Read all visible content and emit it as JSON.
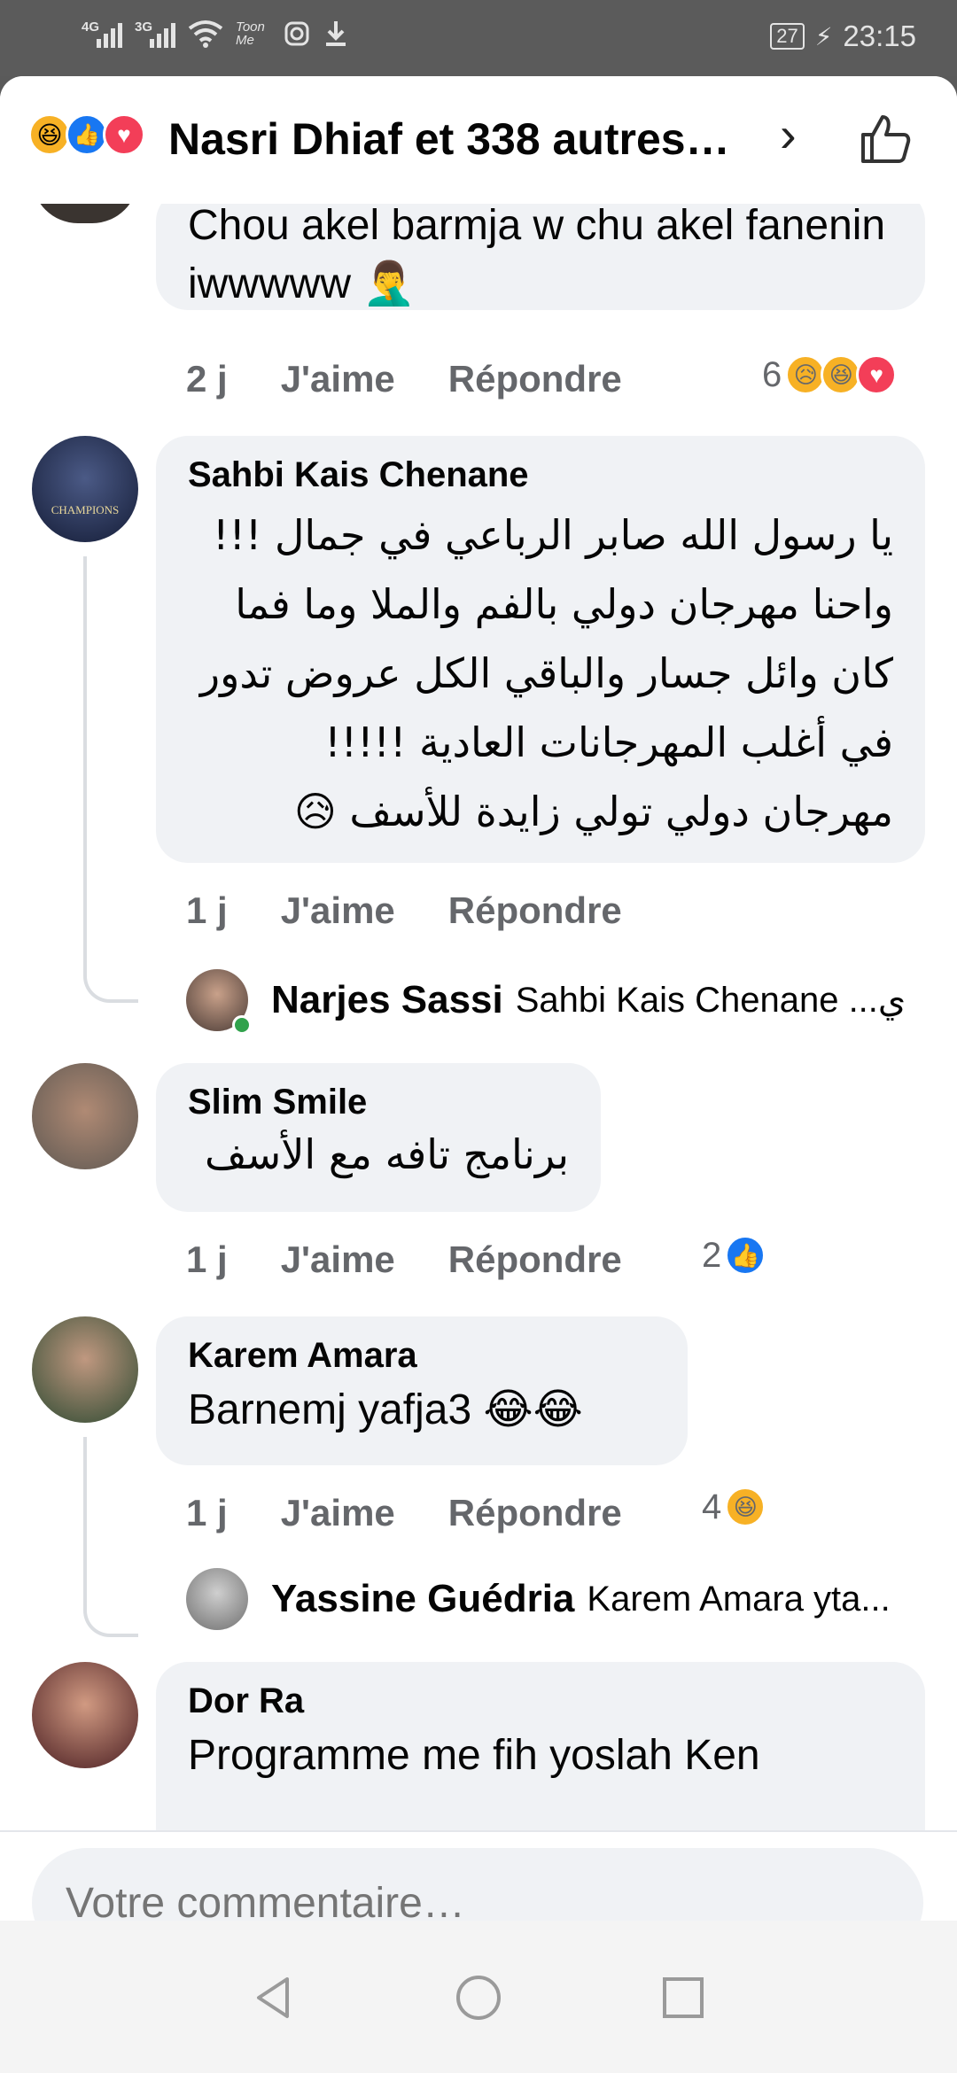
{
  "status_bar": {
    "sig1_label": "4G",
    "sig2_label": "3G",
    "extra_label": "Toon Me",
    "battery": "27",
    "time": "23:15"
  },
  "header": {
    "title": "Nasri Dhiaf et 338 autres…",
    "chevron": "chevron-right-icon",
    "like_icon": "thumbs-up-icon"
  },
  "comments": [
    {
      "text": "Chou akel barmja w chu akel fanenin iwwwww 🤦‍♂️",
      "time": "2 j",
      "like": "J'aime",
      "reply": "Répondre",
      "reactions_count": "6",
      "reaction_emojis": [
        "😥",
        "😆",
        "😍"
      ]
    },
    {
      "author": "Sahbi Kais Chenane",
      "text": "يا رسول الله صابر الرباعي في جمال !!! واحنا مهرجان دولي بالفم والملا وما فما كان وائل جسار والباقي الكل عروض تدور في أغلب المهرجانات العادية !!!!! مهرجان دولي تولي زايدة للأسف 😥",
      "avatar_text": "CHAMPIONS",
      "time": "1 j",
      "like": "J'aime",
      "reply": "Répondre",
      "reply_author": "Narjes Sassi",
      "reply_text": "Sahbi Kais Chenane ...ي"
    },
    {
      "author": "Slim Smile",
      "text": "برنامج تافه مع الأسف",
      "time": "1 j",
      "like": "J'aime",
      "reply": "Répondre",
      "reactions_count": "2"
    },
    {
      "author": "Karem Amara",
      "text": "Barnemj yafja3 😂😂",
      "time": "1 j",
      "like": "J'aime",
      "reply": "Répondre",
      "reactions_count": "4",
      "reply_author": "Yassine Guédria",
      "reply_text": "Karem Amara yta..."
    },
    {
      "author": "Dor Ra",
      "text": "Programme me fih yoslah Ken"
    }
  ],
  "composer": {
    "placeholder": "Votre commentaire…"
  },
  "colors": {
    "accent": "#1877f2",
    "love": "#f33e58",
    "haha": "#f7b125",
    "bubble": "#f0f2f5",
    "meta": "#65676b"
  }
}
